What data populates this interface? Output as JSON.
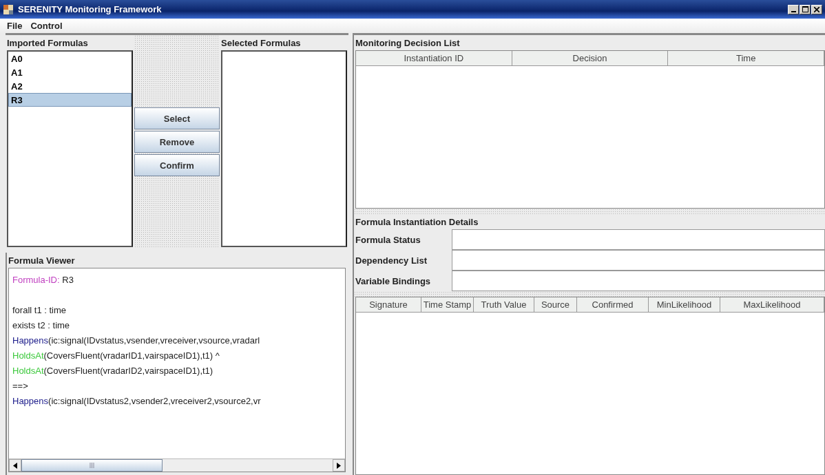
{
  "window": {
    "title": "SERENITY Monitoring Framework"
  },
  "menu": [
    "File",
    "Control"
  ],
  "imported": {
    "title": "Imported Formulas",
    "items": [
      {
        "label": "A0",
        "selected": false
      },
      {
        "label": "A1",
        "selected": false
      },
      {
        "label": "A2",
        "selected": false
      },
      {
        "label": "R3",
        "selected": true
      }
    ]
  },
  "buttons": [
    "Select",
    "Remove",
    "Confirm"
  ],
  "selected_formulas": {
    "title": "Selected Formulas"
  },
  "viewer": {
    "title": "Formula Viewer",
    "id_line": [
      {
        "kind": "label",
        "text": "Formula-ID:"
      },
      {
        "kind": "plain",
        "text": " R3"
      }
    ],
    "lines": [
      {
        "segments": [
          {
            "kind": "plain",
            "text": "forall  t1 : time"
          }
        ]
      },
      {
        "segments": [
          {
            "kind": "plain",
            "text": "exists  t2 : time"
          }
        ]
      },
      {
        "segments": [
          {
            "kind": "event",
            "text": "Happens"
          },
          {
            "kind": "plain",
            "text": "(ic:signal(IDvstatus,vsender,vreceiver,vsource,vradarl"
          }
        ]
      },
      {
        "segments": [
          {
            "kind": "fluent",
            "text": "HoldsAt"
          },
          {
            "kind": "plain",
            "text": "(CoversFluent(vradarID1,vairspaceID1),t1) ^"
          }
        ]
      },
      {
        "segments": [
          {
            "kind": "fluent",
            "text": "HoldsAt"
          },
          {
            "kind": "plain",
            "text": "(CoversFluent(vradarID2,vairspaceID1),t1)"
          }
        ]
      },
      {
        "segments": [
          {
            "kind": "plain",
            "text": "==>"
          }
        ]
      },
      {
        "segments": [
          {
            "kind": "event",
            "text": "Happens"
          },
          {
            "kind": "plain",
            "text": "(ic:signal(IDvstatus2,vsender2,vreceiver2,vsource2,vr"
          }
        ]
      }
    ]
  },
  "decision_list": {
    "title": "Monitoring Decision List",
    "columns": [
      "Instantiation ID",
      "Decision",
      "Time"
    ]
  },
  "details": {
    "title": "Formula Instantiation Details",
    "fields": [
      {
        "label": "Formula Status"
      },
      {
        "label": "Dependency List"
      },
      {
        "label": "Variable Bindings"
      }
    ],
    "columns": [
      "Signature",
      "Time Stamp",
      "Truth Value",
      "Source",
      "Confirmed",
      "MinLikelihood",
      "MaxLikelihood"
    ]
  }
}
